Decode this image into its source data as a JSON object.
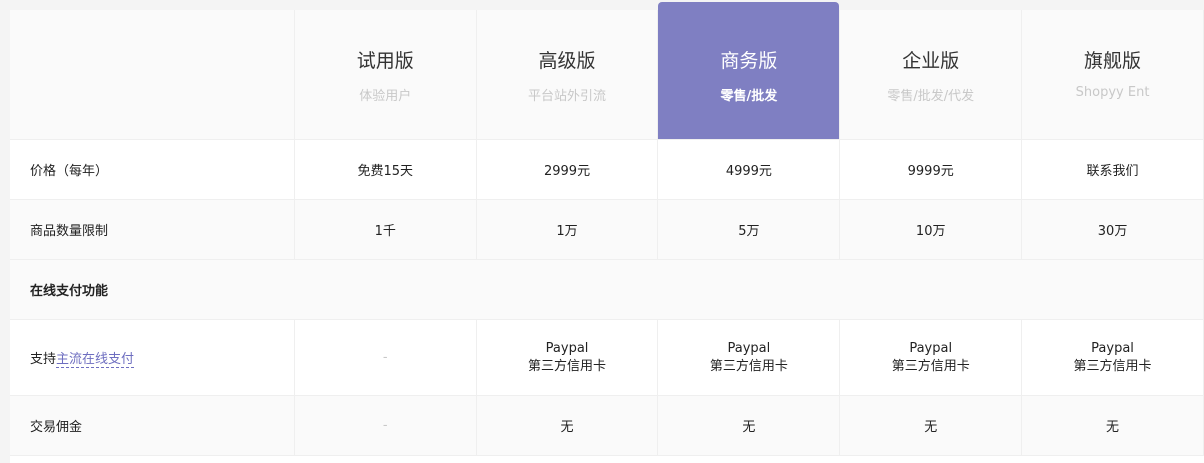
{
  "plans": [
    {
      "name": "试用版",
      "sub": "体验用户"
    },
    {
      "name": "高级版",
      "sub": "平台站外引流"
    },
    {
      "name": "商务版",
      "sub": "零售/批发"
    },
    {
      "name": "企业版",
      "sub": "零售/批发/代发"
    },
    {
      "name": "旗舰版",
      "sub": "Shopyy Ent"
    }
  ],
  "rows": {
    "price": {
      "label": "价格（每年）",
      "values": [
        "免费15天",
        "2999元",
        "4999元",
        "9999元",
        "联系我们"
      ]
    },
    "products": {
      "label": "商品数量限制",
      "values": [
        "1千",
        "1万",
        "5万",
        "10万",
        "30万"
      ]
    },
    "section_payment": {
      "label": "在线支付功能"
    },
    "payment": {
      "label_prefix": "支持",
      "label_link": "主流在线支付",
      "trial": "-",
      "line1": "Paypal",
      "line2": "第三方信用卡"
    },
    "commission": {
      "label": "交易佣金",
      "values": [
        "-",
        "无",
        "无",
        "无",
        "无"
      ]
    }
  },
  "colors": {
    "featured": "#7f7fc2",
    "link": "#6e6ec0"
  }
}
